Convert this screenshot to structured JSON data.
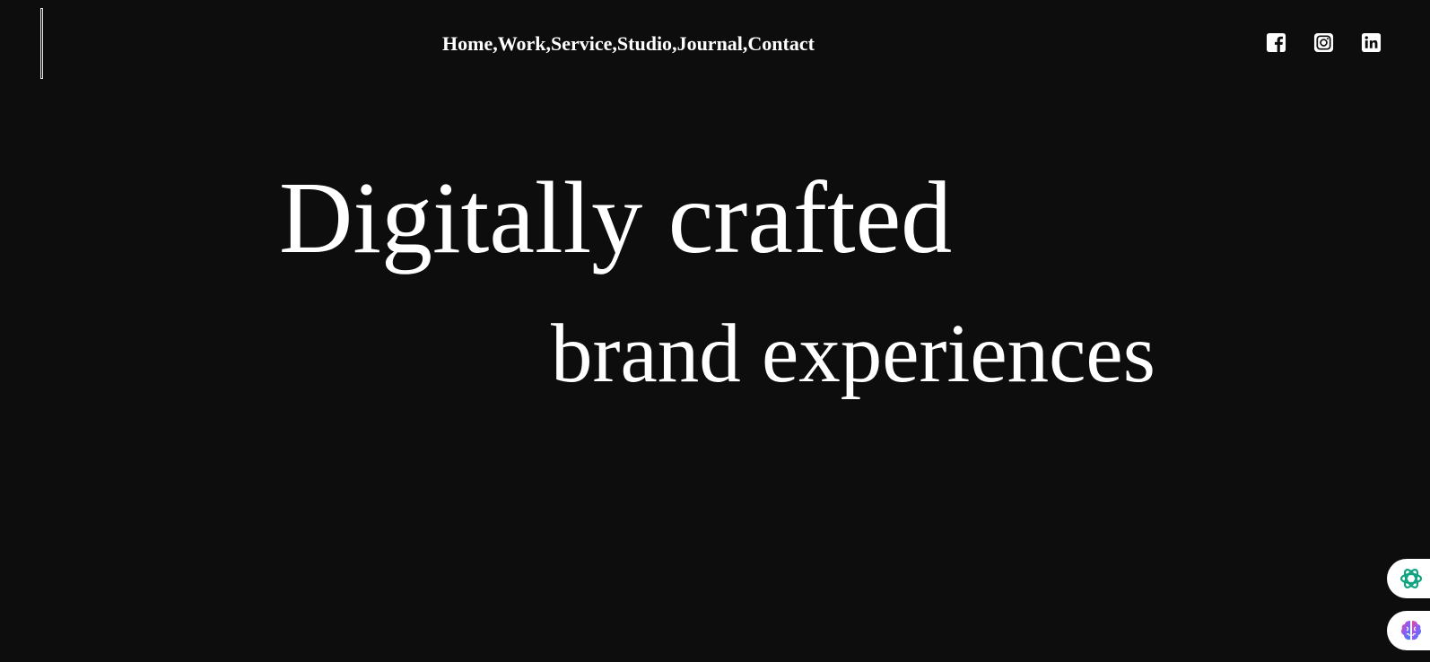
{
  "nav": {
    "items": [
      {
        "label": "Home",
        "sep": ","
      },
      {
        "label": "Work",
        "sep": ","
      },
      {
        "label": "Service",
        "sep": ","
      },
      {
        "label": "Studio",
        "sep": ","
      },
      {
        "label": "Journal",
        "sep": ","
      },
      {
        "label": "Contact",
        "sep": ""
      }
    ]
  },
  "social": {
    "icons": [
      "facebook-icon",
      "instagram-icon",
      "linkedin-icon"
    ]
  },
  "hero": {
    "line1": "Digitally crafted",
    "line2": "brand experiences"
  },
  "floating": {
    "icons": [
      "chatgpt-icon",
      "brain-icon"
    ]
  },
  "colors": {
    "background": "#0e0d0e",
    "text": "#ffffff",
    "chat_accent": "#10a37f",
    "brain_accent": "#8b5cf6"
  }
}
